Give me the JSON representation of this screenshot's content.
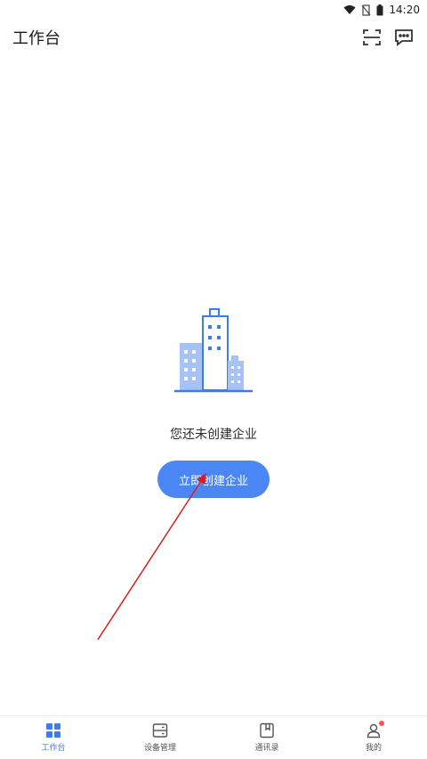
{
  "status_bar": {
    "time": "14:20",
    "icons": [
      "wifi-icon",
      "no-sim-icon",
      "battery-icon"
    ]
  },
  "header": {
    "title": "工作台",
    "actions": [
      "scan-icon",
      "message-icon"
    ]
  },
  "empty_state": {
    "illustration": "building-icon",
    "message": "您还未创建企业",
    "button_label": "立即创建企业"
  },
  "tabbar": {
    "items": [
      {
        "label": "工作台",
        "icon": "grid-icon",
        "active": true
      },
      {
        "label": "设备管理",
        "icon": "device-icon",
        "active": false
      },
      {
        "label": "通讯录",
        "icon": "contacts-icon",
        "active": false
      },
      {
        "label": "我的",
        "icon": "user-icon",
        "active": false,
        "badge": true
      }
    ]
  },
  "colors": {
    "accent": "#4a86f4",
    "tab_active": "#3b7cf0",
    "badge": "#f5554a",
    "annotation": "#d81e1e"
  }
}
